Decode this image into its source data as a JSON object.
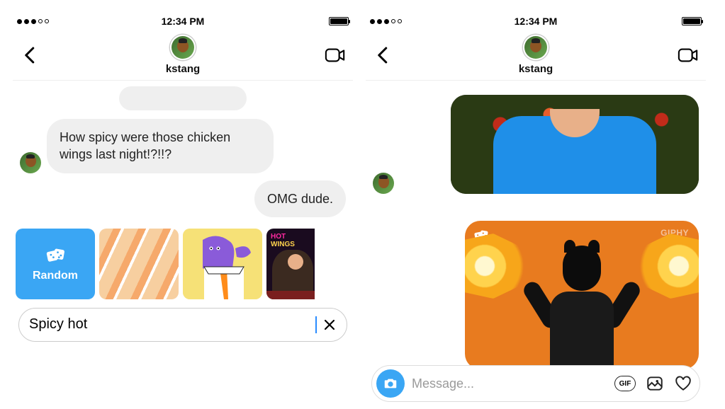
{
  "status_time": "12:34 PM",
  "username": "kstang",
  "left": {
    "received_message": "How spicy were those chicken wings last night!?!!?",
    "sent_message": "OMG dude.",
    "gif_random_label": "Random",
    "gif_wings_text_line1": "HOT",
    "gif_wings_text_line2": "WINGS",
    "search_value": "Spicy hot"
  },
  "right": {
    "giphy_watermark": "GIPHY",
    "composer_placeholder": "Message...",
    "gif_button_label": "GIF"
  }
}
